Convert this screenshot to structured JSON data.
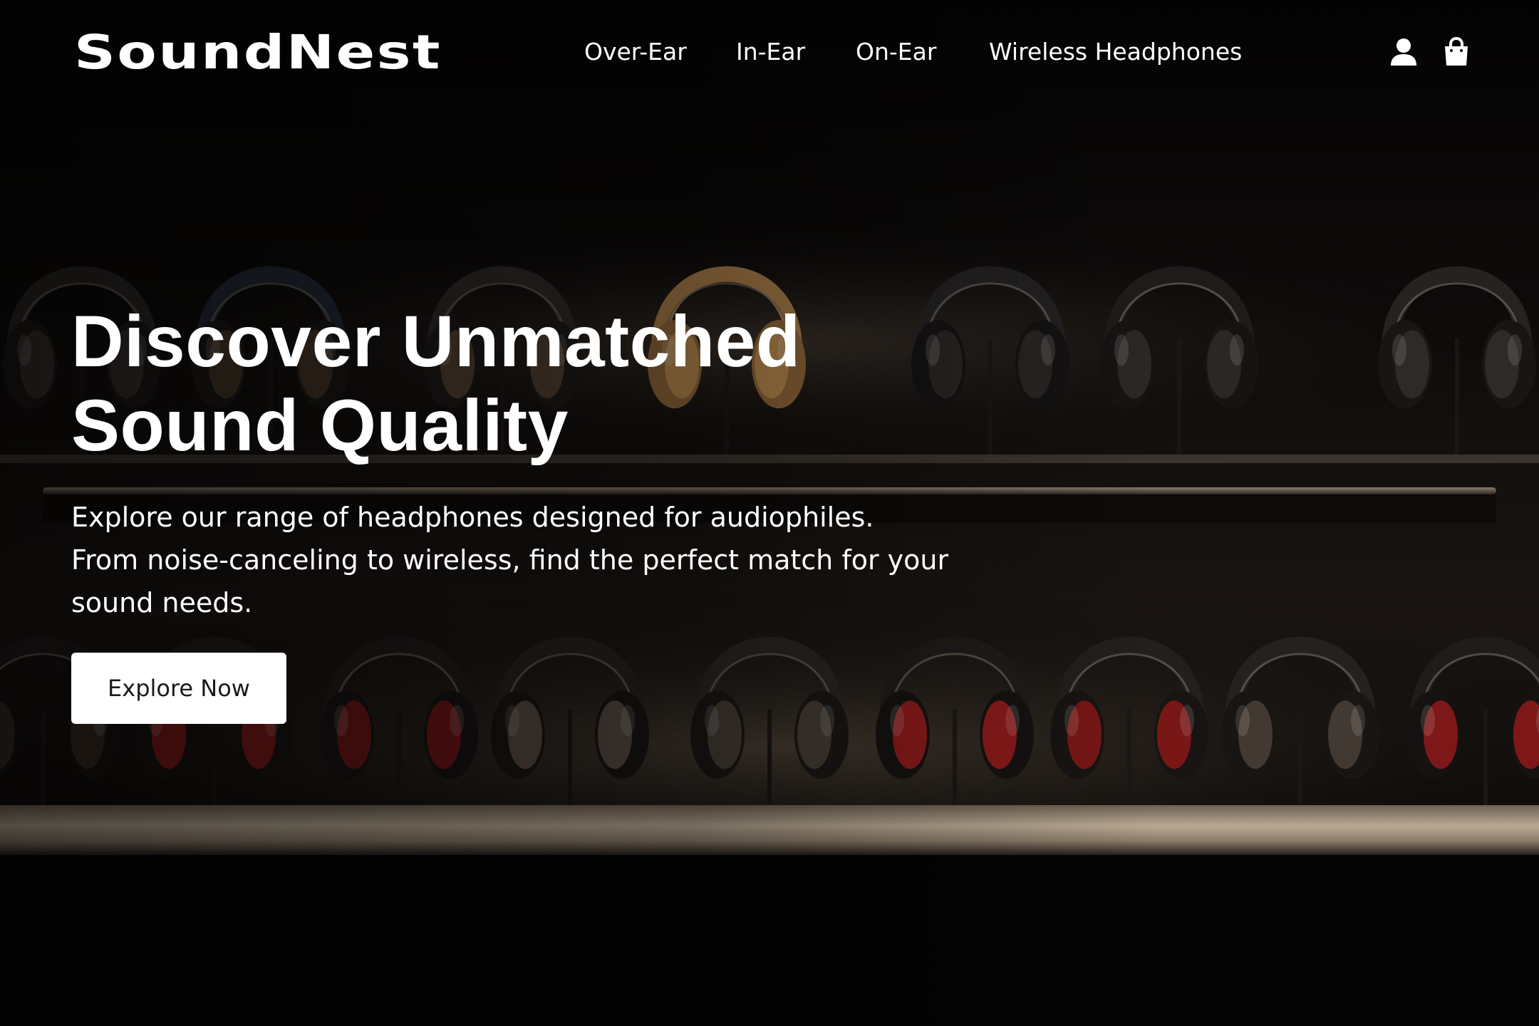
{
  "brand": {
    "name": "SoundNest"
  },
  "nav": {
    "items": [
      {
        "label": "Over-Ear"
      },
      {
        "label": "In-Ear"
      },
      {
        "label": "On-Ear"
      },
      {
        "label": "Wireless Headphones"
      }
    ]
  },
  "header_icons": {
    "account": "user-icon",
    "cart": "shopping-bag-icon"
  },
  "hero": {
    "title_lines": [
      "Discover Unmatched",
      "Sound Quality"
    ],
    "subtitle_lines": [
      "Explore our range of headphones designed for audiophiles.",
      "From noise-canceling to wireless, find the perfect match for your",
      "sound needs."
    ],
    "cta_label": "Explore Now",
    "background": "headphones-display-shelves-image"
  },
  "colors": {
    "background": "#050404",
    "text": "#ffffff",
    "button_bg": "#ffffff",
    "button_text": "#1a1a1a",
    "shelf_glow": "#d9c7b0",
    "accent_gold": "#b8894f",
    "accent_red": "#b01a1a"
  }
}
